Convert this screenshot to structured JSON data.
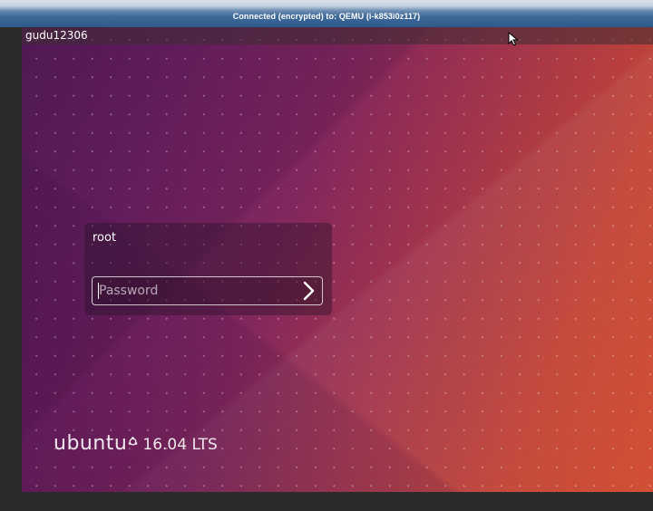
{
  "vnc": {
    "title": "Connected (encrypted) to: QEMU (i-k853i0z117)"
  },
  "panel": {
    "hostname": "gudu12306"
  },
  "login": {
    "username": "root",
    "password_placeholder": "Password",
    "password_value": "",
    "submit_icon": "chevron-right-icon"
  },
  "branding": {
    "wordmark": "ubuntu",
    "logo_icon": "circle-of-friends-icon",
    "version": "16.04 LTS"
  },
  "colors": {
    "vnc_bar": "#2d5a8c",
    "wallpaper_left": "#5a1f5e",
    "wallpaper_right": "#d04a2e",
    "text": "#ffffff"
  }
}
